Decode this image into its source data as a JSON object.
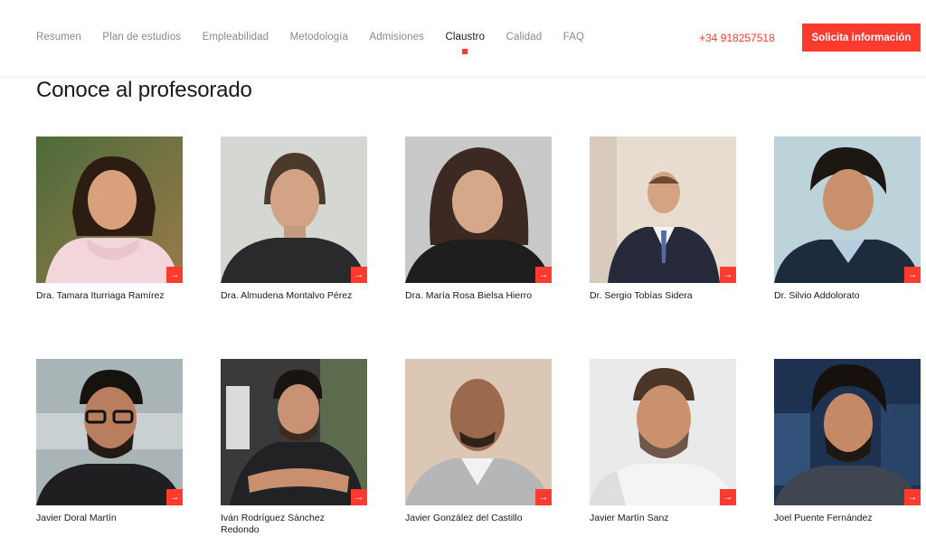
{
  "nav": {
    "items": [
      {
        "label": "Resumen",
        "active": false
      },
      {
        "label": "Plan de estudios",
        "active": false
      },
      {
        "label": "Empleabilidad",
        "active": false
      },
      {
        "label": "Metodología",
        "active": false
      },
      {
        "label": "Admisiones",
        "active": false
      },
      {
        "label": "Claustro",
        "active": true
      },
      {
        "label": "Calidad",
        "active": false
      },
      {
        "label": "FAQ",
        "active": false
      }
    ],
    "phone": "+34 918257518",
    "cta": "Solicita información"
  },
  "section": {
    "title": "Conoce al profesorado"
  },
  "faculty": [
    {
      "name": "Dra. Tamara Iturriaga Ramírez"
    },
    {
      "name": "Dra. Almudena Montalvo Pérez"
    },
    {
      "name": "Dra. María Rosa Bielsa Hierro"
    },
    {
      "name": "Dr. Sergio Tobías Sidera"
    },
    {
      "name": "Dr. Silvio Addolorato"
    },
    {
      "name": "Javier Doral Martín"
    },
    {
      "name": "Iván Rodríguez Sánchez Redondo"
    },
    {
      "name": "Javier González del Castillo"
    },
    {
      "name": "Javier Martín Sanz"
    },
    {
      "name": "Joel Puente Fernández"
    }
  ],
  "colors": {
    "accent": "#ff3b2f",
    "text": "#1a1a1a",
    "muted": "#8a8a8a"
  },
  "icons": {
    "profile_link": "arrow-right-icon"
  }
}
